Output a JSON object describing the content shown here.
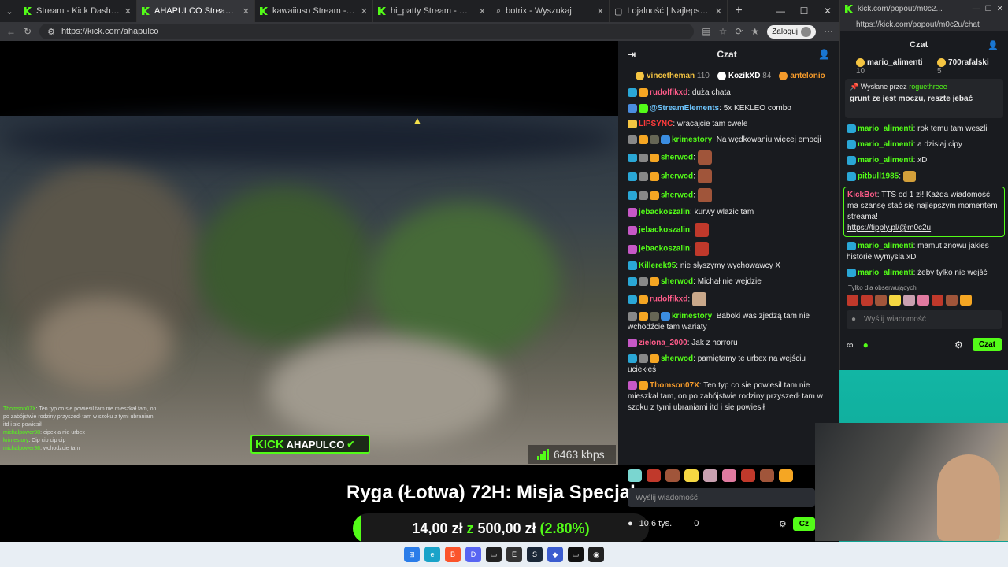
{
  "browser": {
    "tabs": [
      {
        "label": "Stream - Kick Dashboard",
        "icon": "kick-icon",
        "active": false
      },
      {
        "label": "AHAPULCO Stream - Watch",
        "icon": "kick-icon",
        "active": true
      },
      {
        "label": "kawaiiuso Stream - Watch Live o",
        "icon": "kick-icon",
        "active": false
      },
      {
        "label": "hi_patty Stream - Watch Live on",
        "icon": "kick-icon",
        "active": false
      },
      {
        "label": "botrix - Wyszukaj",
        "icon": "search-icon",
        "active": false
      },
      {
        "label": "Lojalność | Najlepsze oprogram",
        "icon": "page-icon",
        "active": false
      }
    ],
    "new_tab": "+",
    "url": "https://kick.com/ahapulco",
    "login_label": "Zaloguj"
  },
  "video": {
    "logo_kick": "KICK",
    "logo_name": "AHAPULCO",
    "bitrate": "6463 kbps",
    "overlay_chat": [
      {
        "user": "Thomson07X",
        "text": "Ten typ co sie powiesil tam nie mieszkał tam, on po zabójstwie rodziny przyszedł tam w szoku z tymi ubraniami itd i sie powiesił"
      },
      {
        "user": "michalpower98",
        "text": "cipex a nie urbex"
      },
      {
        "user": "krimestory",
        "text": "Cip cip cip cip"
      },
      {
        "user": "michalpower98",
        "text": "wchodzcie tam"
      }
    ]
  },
  "banner": {
    "title": "Ryga (Łotwa) 72H: Misja Specjalna",
    "raised": "14,00 zł",
    "z": "z",
    "goal": "500,00 zł",
    "percent_label": "(2.80%)",
    "progress": 0.028
  },
  "chat": {
    "title": "Czat",
    "pinned": [
      {
        "user": "vincetheman",
        "count": "110",
        "color": "#f5c542"
      },
      {
        "user": "KozikXD",
        "count": "84",
        "color": "#ffffff"
      },
      {
        "user": "antelonio",
        "count": "",
        "color": "#f59b2b"
      }
    ],
    "messages": [
      {
        "user": "rudolfikxd",
        "color": "#ff5c8a",
        "text": "duża chata",
        "badges": [
          "sub33",
          "crown"
        ]
      },
      {
        "user": "@StreamElements",
        "color": "#6ec6ff",
        "text": "5x KEKLEO combo",
        "badges": [
          "bot",
          "verified"
        ]
      },
      {
        "user": "LIPSYNC",
        "color": "#ff3b3b",
        "text": "wracajcie tam cwele",
        "badges": [
          "kick"
        ]
      },
      {
        "user": "krimestory",
        "color": "#53fc18",
        "text": "Na wędkowaniu więcej emocji",
        "badges": [
          "sub22",
          "crown",
          "figure",
          "sword"
        ]
      },
      {
        "user": "sherwod",
        "color": "#53fc18",
        "text": "",
        "badges": [
          "sub39",
          "sub22",
          "crown"
        ],
        "emote": "face"
      },
      {
        "user": "sherwod",
        "color": "#53fc18",
        "text": "",
        "badges": [
          "sub39",
          "sub22",
          "crown"
        ],
        "emote": "face"
      },
      {
        "user": "sherwod",
        "color": "#53fc18",
        "text": "",
        "badges": [
          "sub39",
          "sub22",
          "crown"
        ],
        "emote": "face"
      },
      {
        "user": "jebackoszalin",
        "color": "#53fc18",
        "text": "kurwy wlazic tam",
        "badges": [
          "sub21"
        ]
      },
      {
        "user": "jebackoszalin",
        "color": "#53fc18",
        "text": "",
        "badges": [
          "sub21"
        ],
        "emote": "angry"
      },
      {
        "user": "jebackoszalin",
        "color": "#53fc18",
        "text": "",
        "badges": [
          "sub21"
        ],
        "emote": "angry"
      },
      {
        "user": "Killerek95",
        "color": "#53fc18",
        "text": "nie słyszymy wychowawcy X",
        "badges": [
          "sub38"
        ]
      },
      {
        "user": "sherwod",
        "color": "#53fc18",
        "text": "Michał nie wejdzie",
        "badges": [
          "sub39",
          "sub22",
          "crown"
        ]
      },
      {
        "user": "rudolfikxd",
        "color": "#ff5c8a",
        "text": "",
        "badges": [
          "sub33",
          "crown"
        ],
        "emote": "cat"
      },
      {
        "user": "krimestory",
        "color": "#53fc18",
        "text": "Baboki was zjedzą tam nie wchodźcie tam wariaty",
        "badges": [
          "sub22",
          "crown",
          "figure",
          "sword"
        ]
      },
      {
        "user": "zielona_2000",
        "color": "#ff5c8a",
        "text": "Jak z horroru",
        "badges": [
          "sub21"
        ]
      },
      {
        "user": "sherwod",
        "color": "#53fc18",
        "text": "pamiętamy te urbex na wejściu uciekłeś",
        "badges": [
          "sub39",
          "sub22",
          "crown"
        ]
      },
      {
        "user": "Thomson07X",
        "color": "#f59b2b",
        "text": "Ten typ co sie powiesil tam nie mieszkał tam, on po zabójstwie rodziny przyszedł tam w szoku z tymi ubraniami itd i sie powiesił",
        "badges": [
          "sub28",
          "crown"
        ]
      },
      {
        "user": "michalpower98",
        "color": "#53fc18",
        "text": "cipex a nie urbex",
        "badges": [
          "sub28",
          "crown"
        ]
      },
      {
        "user": "krimestory",
        "color": "#53fc18",
        "text": "Cip cip cip cip",
        "badges": [
          "sub22",
          "crown",
          "figure",
          "sword"
        ]
      },
      {
        "user": "michalpower98",
        "color": "#53fc18",
        "text": "wchodzcie tam",
        "badges": [
          "sub28",
          "crown"
        ]
      }
    ],
    "input_placeholder": "Wyślij wiadomość",
    "viewers": "10,6 tys.",
    "points": "0",
    "send_label": "Cz"
  },
  "popout": {
    "url": "kick.com/popout/m0c2...",
    "full_url": "https://kick.com/popout/m0c2u/chat",
    "title": "Czat",
    "top_users": [
      {
        "user": "mario_alimenti",
        "count": "10"
      },
      {
        "user": "700rafalski",
        "count": "5"
      }
    ],
    "pinned_by_label": "Wysłane przez",
    "pinned_by_user": "roguethreee",
    "pinned_text": "grunt ze jest moczu, reszte jebać",
    "messages": [
      {
        "user": "mario_alimenti",
        "text": "rok temu tam weszli"
      },
      {
        "user": "mario_alimenti",
        "text": "a dzisiaj cipy"
      },
      {
        "user": "mario_alimenti",
        "text": "xD"
      },
      {
        "user": "pitbull1985",
        "text": ""
      }
    ],
    "kickbot_user": "KickBot",
    "kickbot_text": "TTS od 1 zł! Każda wiadomość ma szansę stać się najlepszym momentem streama!",
    "kickbot_link": "https://tipply.pl/@m0c2u",
    "messages2": [
      {
        "user": "mario_alimenti",
        "text": "mamut znowu jakies historie wymysla xD"
      },
      {
        "user": "mario_alimenti",
        "text": "żeby tylko nie wejść"
      }
    ],
    "followers_only": "Tylko dla obserwujących",
    "input_placeholder": "Wyślij wiadomość",
    "send_label": "Czat"
  },
  "colors": {
    "accent": "#53fc18",
    "bg": "#191b1f"
  }
}
